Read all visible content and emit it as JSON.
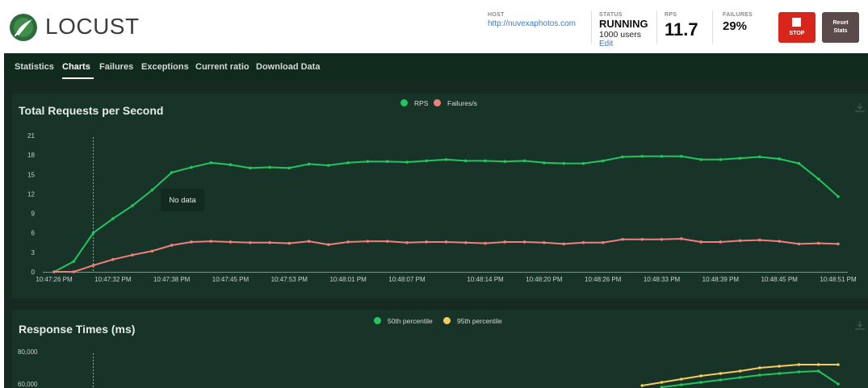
{
  "header": {
    "logo_text": "LOCUST",
    "host_label": "HOST",
    "host_value": "http://nuvexaphotos.com",
    "status_label": "STATUS",
    "status_value": "RUNNING",
    "users_text": "1000 users",
    "edit_label": "Edit",
    "rps_label": "RPS",
    "rps_value": "11.7",
    "failures_label": "FAILURES",
    "failures_value": "29%",
    "stop_label": "STOP",
    "reset_label_1": "Reset",
    "reset_label_2": "Stats"
  },
  "nav": {
    "tabs": [
      "Statistics",
      "Charts",
      "Failures",
      "Exceptions",
      "Current ratio",
      "Download Data"
    ],
    "active": "Charts"
  },
  "colors": {
    "rps": "#22c55e",
    "failures": "#f37f7a",
    "p50": "#22c55e",
    "p95": "#f6cc5d",
    "header_bg": "#ffffff",
    "nav_bg": "#102a1e",
    "panel_bg": "#183428",
    "stop": "#d9261c",
    "reset": "#5b4a4a"
  },
  "chart_data": [
    {
      "type": "line",
      "title": "Total Requests per Second",
      "tooltip": "No data",
      "x_ticks": [
        "10:47:26 PM",
        "10:47:32 PM",
        "10:47:38 PM",
        "10:47:45 PM",
        "10:47:53 PM",
        "10:48:01 PM",
        "10:48:07 PM",
        "10:48:14 PM",
        "10:48:20 PM",
        "10:48:26 PM",
        "10:48:33 PM",
        "10:48:39 PM",
        "10:48:45 PM",
        "10:48:51 PM"
      ],
      "y_ticks": [
        0,
        3,
        6,
        9,
        12,
        15,
        18,
        21
      ],
      "ylim": [
        0,
        21
      ],
      "grid": false,
      "legend": "top-center",
      "series": [
        {
          "name": "RPS",
          "color": "#22c55e",
          "values": [
            0,
            1.6,
            6.0,
            8.2,
            10.2,
            12.6,
            15.3,
            16.1,
            16.8,
            16.5,
            16.0,
            16.1,
            16.0,
            16.6,
            16.4,
            16.8,
            17.0,
            17.0,
            16.9,
            17.1,
            17.3,
            17.1,
            17.1,
            17.0,
            17.1,
            16.8,
            16.7,
            16.7,
            17.1,
            17.7,
            17.8,
            17.8,
            17.8,
            17.3,
            17.3,
            17.5,
            17.7,
            17.4,
            16.7,
            14.3,
            11.6
          ]
        },
        {
          "name": "Failures/s",
          "color": "#f37f7a",
          "values": [
            0,
            0,
            1.0,
            1.9,
            2.6,
            3.2,
            4.1,
            4.6,
            4.7,
            4.6,
            4.5,
            4.5,
            4.4,
            4.7,
            4.2,
            4.6,
            4.7,
            4.7,
            4.5,
            4.6,
            4.6,
            4.5,
            4.4,
            4.6,
            4.6,
            4.5,
            4.3,
            4.5,
            4.5,
            5.0,
            5.0,
            5.0,
            5.1,
            4.6,
            4.6,
            4.8,
            4.9,
            4.7,
            4.3,
            4.4,
            4.3
          ]
        }
      ]
    },
    {
      "type": "line",
      "title": "Response Times (ms)",
      "y_ticks_visible": [
        "80,000",
        "60,000"
      ],
      "legend": "top-center",
      "series": [
        {
          "name": "50th percentile",
          "color": "#22c55e",
          "values": [
            null,
            null,
            null,
            null,
            null,
            null,
            null,
            null,
            null,
            null,
            null,
            null,
            null,
            null,
            null,
            null,
            null,
            null,
            null,
            null,
            null,
            null,
            null,
            null,
            null,
            null,
            null,
            null,
            null,
            null,
            null,
            58000,
            59500,
            61000,
            62500,
            64000,
            65500,
            66500,
            67500,
            68000,
            60000
          ]
        },
        {
          "name": "95th percentile",
          "color": "#f6cc5d",
          "values": [
            null,
            null,
            null,
            null,
            null,
            null,
            null,
            null,
            null,
            null,
            null,
            null,
            null,
            null,
            null,
            null,
            null,
            null,
            null,
            null,
            null,
            null,
            null,
            null,
            null,
            null,
            null,
            null,
            null,
            null,
            59000,
            61000,
            63000,
            65000,
            66500,
            68000,
            70000,
            71000,
            72000,
            72000,
            72000
          ]
        }
      ]
    }
  ]
}
